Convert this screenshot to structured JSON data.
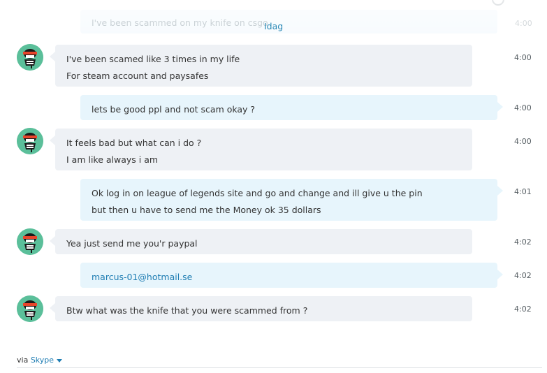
{
  "colors": {
    "accent": "#1f7db3",
    "incoming_bubble": "#eef1f5",
    "outgoing_bubble": "#e7f5fc",
    "avatar_bg": "#5bbf9a"
  },
  "faded": {
    "text": "I've been scammed on my knife on csgo",
    "time": "4:00"
  },
  "date_label": "Idag",
  "messages": [
    {
      "lines": [
        "I've been scamed like 3 times in my life",
        "For steam account and paysafes"
      ],
      "time": "4:00"
    },
    {
      "lines": [
        "lets be good ppl and not scam okay ?"
      ],
      "time": "4:00"
    },
    {
      "lines": [
        "It feels bad but what can i do  ?",
        "I am like always i am"
      ],
      "time": "4:00"
    },
    {
      "lines": [
        "Ok log in on league of legends site and go and change and ill give u the pin",
        "but then u have to send me the Money ok 35 dollars"
      ],
      "time": "4:01"
    },
    {
      "lines": [
        "Yea just send me you'r paypal"
      ],
      "time": "4:02"
    },
    {
      "lines": [
        "marcus-01@hotmail.se"
      ],
      "time": "4:02"
    },
    {
      "lines": [
        "Btw what was the knife that you were scammed from  ?"
      ],
      "time": "4:02"
    }
  ],
  "footer": {
    "via": "via",
    "brand": "Skype"
  },
  "icons": {
    "avatar": "ninja-avatar-icon",
    "dropdown": "chevron-down-icon"
  }
}
